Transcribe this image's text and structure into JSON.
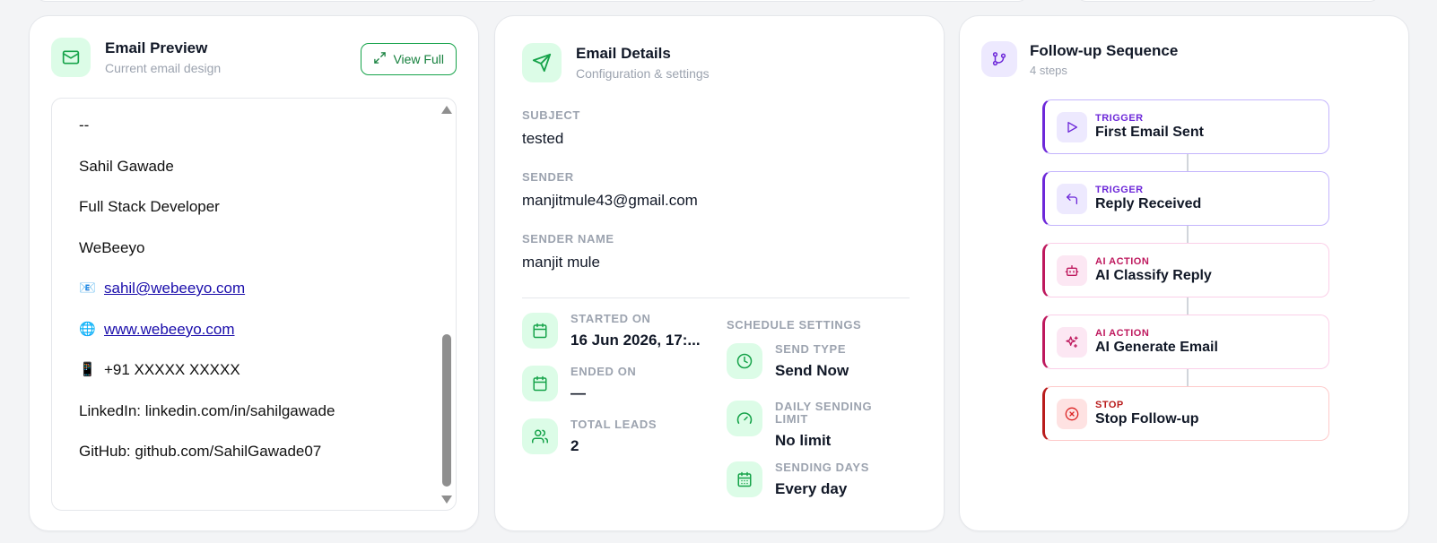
{
  "email_preview": {
    "title": "Email Preview",
    "subtitle": "Current email design",
    "view_full_label": "View Full",
    "lines": {
      "separator": "--",
      "name": "Sahil Gawade",
      "role": "Full Stack Developer",
      "company": "WeBeeyo",
      "email": "sahil@webeeyo.com",
      "website": "www.webeeyo.com",
      "phone": "+91 XXXXX XXXXX",
      "linkedin": "LinkedIn: linkedin.com/in/sahilgawade",
      "github": "GitHub: github.com/SahilGawade07"
    },
    "icons": {
      "email": "📧",
      "website": "🌐",
      "phone": "📱"
    }
  },
  "email_details": {
    "title": "Email Details",
    "subtitle": "Configuration & settings",
    "subject_label": "SUBJECT",
    "subject": "tested",
    "sender_label": "SENDER",
    "sender": "manjitmule43@gmail.com",
    "sender_name_label": "SENDER NAME",
    "sender_name": "manjit mule",
    "started_label": "STARTED ON",
    "started": "16 Jun 2026, 17:...",
    "ended_label": "ENDED ON",
    "ended": "—",
    "leads_label": "TOTAL LEADS",
    "leads": "2",
    "schedule_title": "SCHEDULE SETTINGS",
    "send_type_label": "SEND TYPE",
    "send_type": "Send Now",
    "daily_limit_label_1": "DAILY SENDING",
    "daily_limit_label_2": "LIMIT",
    "daily_limit": "No limit",
    "sending_days_label": "SENDING DAYS",
    "sending_days": "Every day"
  },
  "follow_up": {
    "title": "Follow-up Sequence",
    "subtitle": "4 steps",
    "steps": [
      {
        "kind": "TRIGGER",
        "name": "First Email Sent",
        "icon": "play-icon"
      },
      {
        "kind": "TRIGGER",
        "name": "Reply Received",
        "icon": "reply-icon"
      },
      {
        "kind": "AI ACTION",
        "name": "AI Classify Reply",
        "icon": "bot-icon"
      },
      {
        "kind": "AI ACTION",
        "name": "AI Generate Email",
        "icon": "sparkles-icon"
      },
      {
        "kind": "STOP",
        "name": "Stop Follow-up",
        "icon": "x-circle-icon"
      }
    ]
  },
  "colors": {
    "accent_green": "#16a34a",
    "trigger_purple": "#6d28d9",
    "ai_pink": "#be185d",
    "stop_red": "#b91c1c"
  }
}
